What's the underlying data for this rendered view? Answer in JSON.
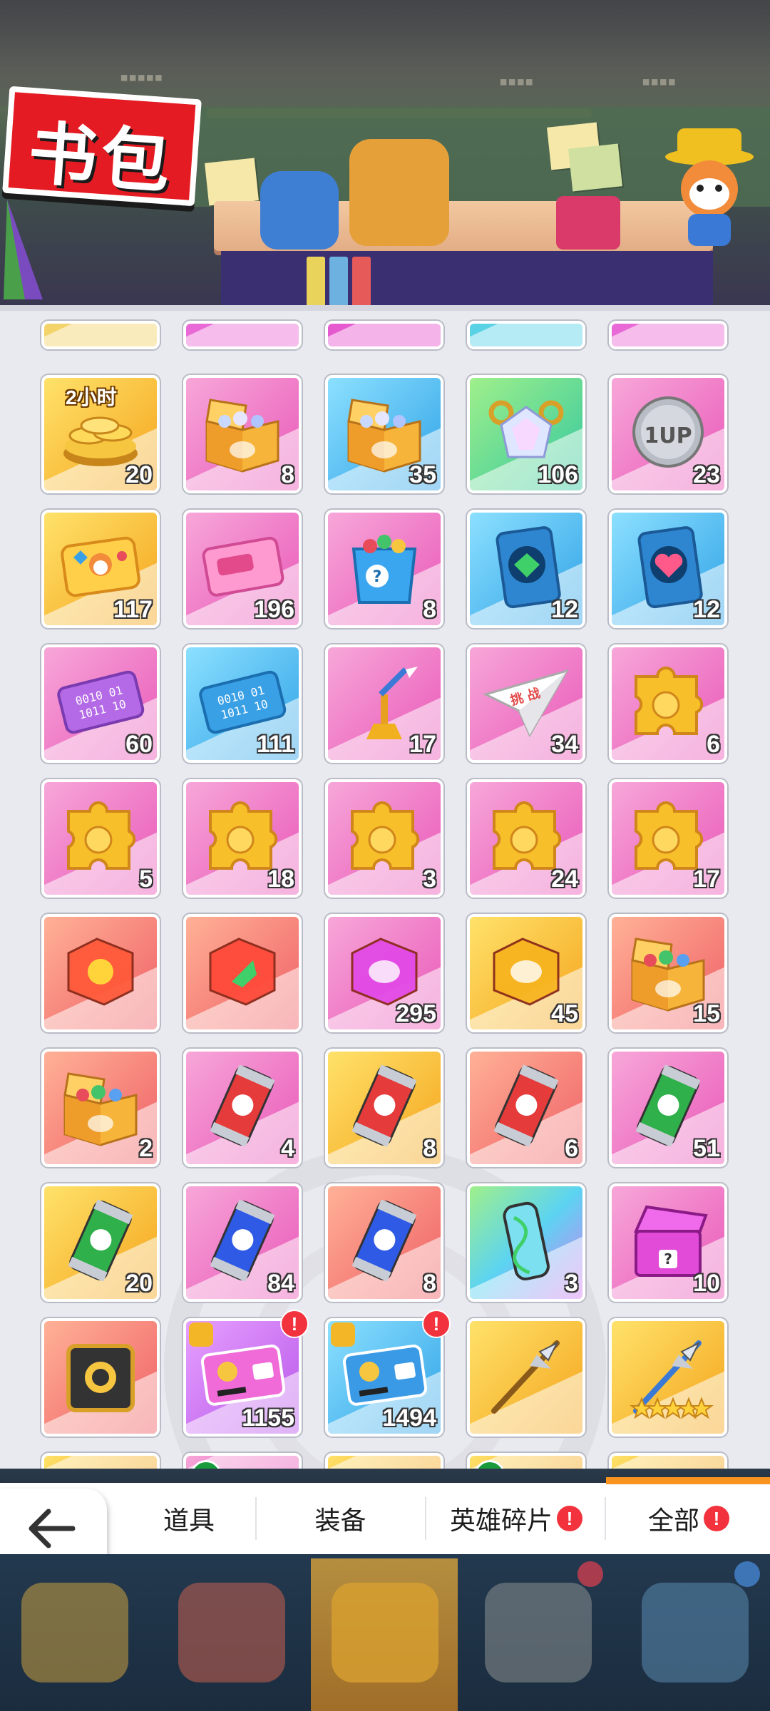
{
  "header": {
    "title": "书包"
  },
  "grid": {
    "rows": [
      [
        {
          "bg": "gold",
          "icon": "coins-2h-icon",
          "tag": "2小时",
          "count": "20"
        },
        {
          "bg": "pink",
          "icon": "gem-box-icon",
          "count": "8"
        },
        {
          "bg": "blue",
          "icon": "gem-box-icon",
          "count": "35"
        },
        {
          "bg": "green",
          "icon": "diamond-chest-icon",
          "count": "106"
        },
        {
          "bg": "pink",
          "icon": "1up-coin-icon",
          "count": "23"
        }
      ],
      [
        {
          "bg": "gold",
          "icon": "gold-card-icon",
          "count": "117"
        },
        {
          "bg": "pink",
          "icon": "pink-ticket-icon",
          "count": "196"
        },
        {
          "bg": "pink",
          "icon": "mystery-bag-icon",
          "count": "8"
        },
        {
          "bg": "blue",
          "icon": "green-card-icon",
          "count": "12"
        },
        {
          "bg": "blue",
          "icon": "heart-card-icon",
          "count": "12"
        }
      ],
      [
        {
          "bg": "pink",
          "icon": "binary-card-purple-icon",
          "count": "60"
        },
        {
          "bg": "blue",
          "icon": "binary-card-blue-icon",
          "count": "111"
        },
        {
          "bg": "pink",
          "icon": "dart-trophy-icon",
          "count": "17"
        },
        {
          "bg": "pink",
          "icon": "paper-plane-icon",
          "count": "34"
        },
        {
          "bg": "pink",
          "icon": "puzzle-piece-icon",
          "count": "6"
        }
      ],
      [
        {
          "bg": "pink",
          "icon": "puzzle-piece-icon",
          "count": "5"
        },
        {
          "bg": "pink",
          "icon": "puzzle-piece-icon",
          "count": "18"
        },
        {
          "bg": "pink",
          "icon": "puzzle-piece-icon",
          "count": "3"
        },
        {
          "bg": "pink",
          "icon": "puzzle-piece-icon",
          "count": "24"
        },
        {
          "bg": "pink",
          "icon": "puzzle-piece-icon",
          "count": "17"
        }
      ],
      [
        {
          "bg": "red",
          "icon": "sun-badge-icon",
          "count": ""
        },
        {
          "bg": "red",
          "icon": "leaf-badge-icon",
          "count": ""
        },
        {
          "bg": "pink",
          "icon": "purple-badge-icon",
          "count": "295"
        },
        {
          "bg": "gold",
          "icon": "gold-badge-icon",
          "count": "45"
        },
        {
          "bg": "red",
          "icon": "gift-box-icon",
          "count": "15"
        }
      ],
      [
        {
          "bg": "red",
          "icon": "gift-box-icon",
          "count": "2"
        },
        {
          "bg": "pink",
          "icon": "red-can-icon",
          "count": "4"
        },
        {
          "bg": "gold",
          "icon": "red-can-icon",
          "count": "8"
        },
        {
          "bg": "red",
          "icon": "red-can-icon",
          "count": "6"
        },
        {
          "bg": "pink",
          "icon": "green-can-icon",
          "count": "51"
        }
      ],
      [
        {
          "bg": "gold",
          "icon": "green-can-icon",
          "count": "20"
        },
        {
          "bg": "pink",
          "icon": "blue-can-icon",
          "count": "84"
        },
        {
          "bg": "red",
          "icon": "blue-can-icon",
          "count": "8"
        },
        {
          "bg": "rainbow",
          "icon": "dna-capsule-icon",
          "count": "3"
        },
        {
          "bg": "pink",
          "icon": "purple-chest-icon",
          "count": "10"
        }
      ],
      [
        {
          "bg": "red",
          "icon": "black-gold-box-icon",
          "count": ""
        },
        {
          "bg": "purple",
          "icon": "pink-coupon-icon",
          "count": "1155",
          "alert": true,
          "puzzle": true
        },
        {
          "bg": "blue",
          "icon": "blue-coupon-icon",
          "count": "1494",
          "alert": true,
          "puzzle": true
        },
        {
          "bg": "gold",
          "icon": "spear-weapon-icon",
          "count": ""
        },
        {
          "bg": "gold",
          "icon": "star-spear-icon",
          "count": ""
        }
      ]
    ]
  },
  "tabs": [
    {
      "label": "道具",
      "alert": false
    },
    {
      "label": "装备",
      "alert": false
    },
    {
      "label": "英雄碎片",
      "alert": true
    },
    {
      "label": "全部",
      "alert": true
    }
  ],
  "alert_symbol": "!",
  "back": {
    "label": "返回"
  },
  "colors": {
    "accent": "#f7931e",
    "alert": "#f2333d"
  }
}
